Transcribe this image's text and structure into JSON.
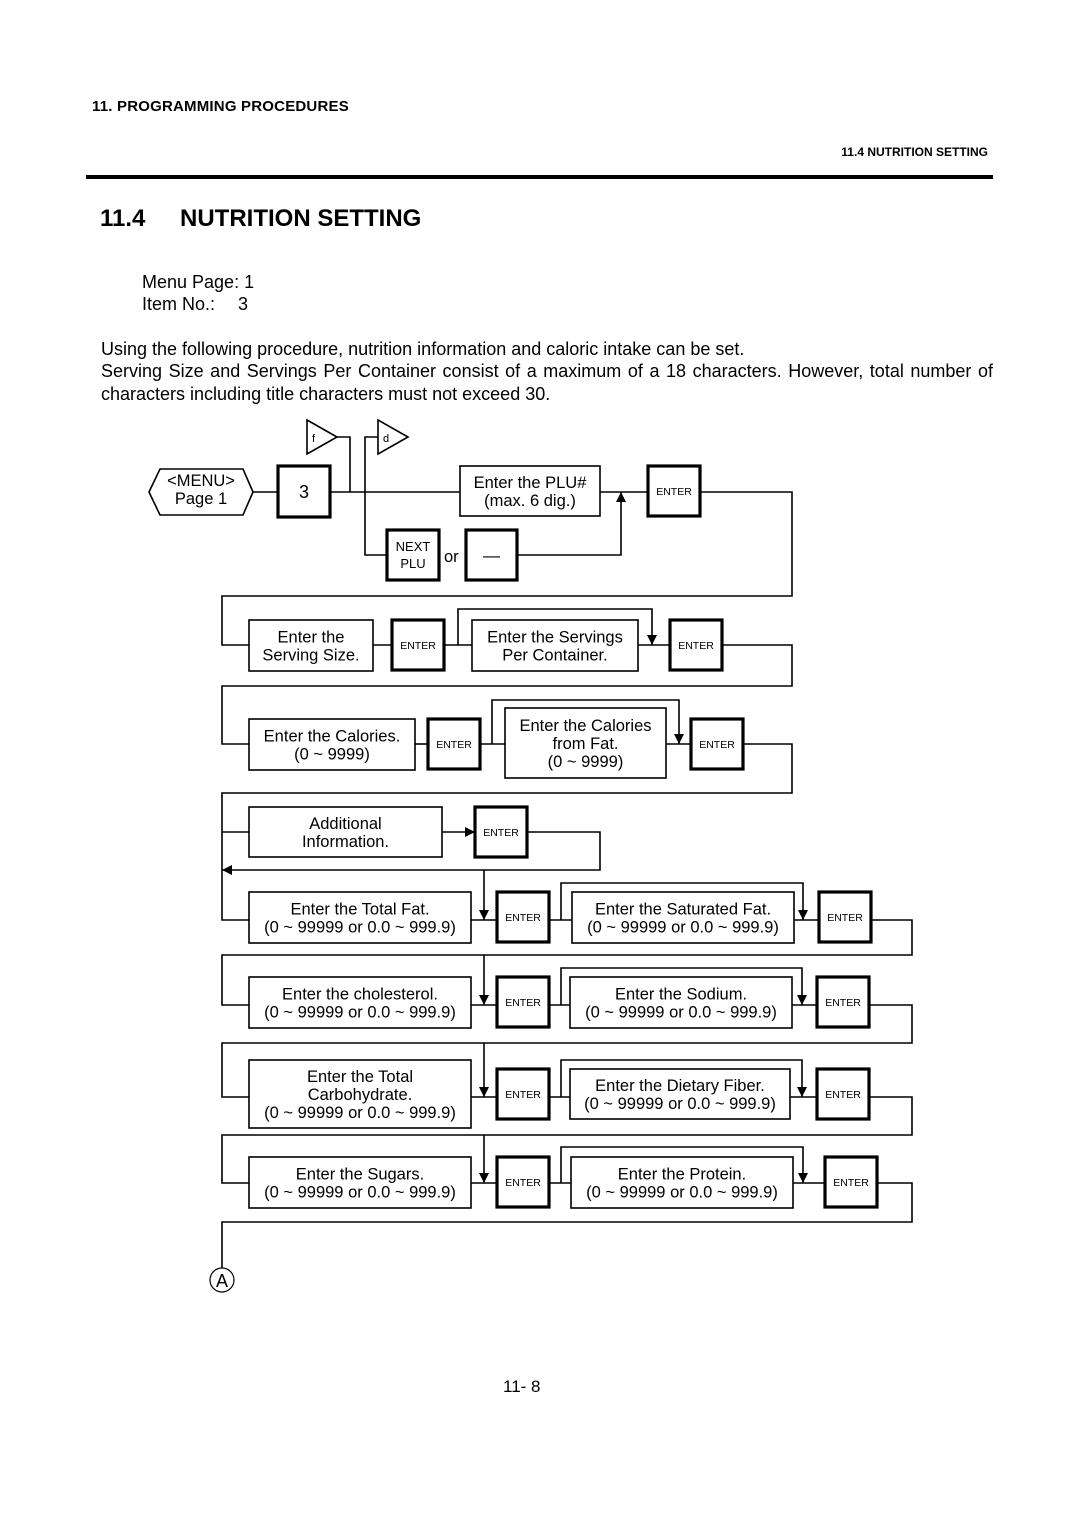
{
  "header": {
    "chapter": "11.  PROGRAMMING PROCEDURES",
    "section_ref": "11.4 NUTRITION SETTING"
  },
  "title": {
    "number": "11.4",
    "text": "NUTRITION SETTING"
  },
  "meta": {
    "menu_page_label": "Menu Page:",
    "menu_page_value": "1",
    "item_no_label": "Item No.:",
    "item_no_value": "3"
  },
  "intro": [
    "Using the following procedure, nutrition information and caloric intake can be set.",
    "Serving Size and Servings Per Container consist of a maximum of a 18 characters.   However, total number of characters including title characters must not exceed 30."
  ],
  "flow": {
    "start": [
      "<MENU>",
      "Page 1"
    ],
    "item_key": "3",
    "flag_f": "f",
    "flag_d": "d",
    "next_plu": [
      "NEXT",
      "PLU"
    ],
    "or": "or",
    "minus_key": "—",
    "enter": "ENTER",
    "plu_box": [
      "Enter the PLU#",
      "(max. 6 dig.)"
    ],
    "serving_size": [
      "Enter the",
      "Serving Size."
    ],
    "servings_per_container": [
      "Enter the Servings",
      "Per Container."
    ],
    "calories": [
      "Enter the Calories.",
      "(0 ~ 9999)"
    ],
    "calories_from_fat": [
      "Enter the Calories",
      "from Fat.",
      "(0 ~ 9999)"
    ],
    "additional_info": [
      "Additional",
      "Information."
    ],
    "total_fat": [
      "Enter the Total Fat.",
      "(0 ~ 99999 or 0.0 ~ 999.9)"
    ],
    "saturated_fat": [
      "Enter the Saturated Fat.",
      "(0 ~ 99999 or 0.0 ~ 999.9)"
    ],
    "cholesterol": [
      "Enter the cholesterol.",
      "(0 ~ 99999 or 0.0 ~ 999.9)"
    ],
    "sodium": [
      "Enter the Sodium.",
      "(0 ~ 99999 or 0.0 ~ 999.9)"
    ],
    "total_carbohydrate": [
      "Enter the Total",
      "Carbohydrate.",
      "(0 ~ 99999 or 0.0 ~ 999.9)"
    ],
    "dietary_fiber": [
      "Enter the Dietary Fiber.",
      "(0 ~ 99999 or 0.0 ~ 999.9)"
    ],
    "sugars": [
      "Enter the Sugars.",
      "(0 ~ 99999 or 0.0 ~ 999.9)"
    ],
    "protein": [
      "Enter the Protein.",
      "(0 ~ 99999 or 0.0 ~ 999.9)"
    ],
    "connector": "A"
  },
  "footer": {
    "page_number": "11- 8"
  }
}
